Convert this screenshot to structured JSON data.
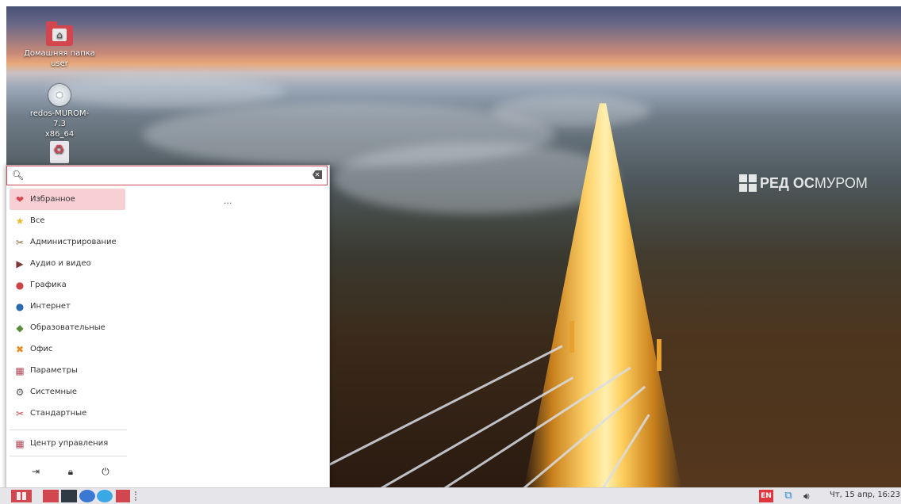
{
  "desktop": {
    "icons": [
      {
        "label_line1": "Домашняя папка",
        "label_line2": "user"
      },
      {
        "label_line1": "redos-MUROM-7.3",
        "label_line2": "x86_64"
      }
    ],
    "watermark": {
      "part1": "РЕД ОС",
      "part2": "МУРОМ"
    }
  },
  "menu": {
    "search": {
      "value": "",
      "placeholder": ""
    },
    "categories": [
      {
        "label": "Избранное",
        "icon": "heart-icon",
        "active": true
      },
      {
        "label": "Все",
        "icon": "star-icon"
      },
      {
        "label": "Администрирование",
        "icon": "tools-icon"
      },
      {
        "label": "Аудио и видео",
        "icon": "film-icon"
      },
      {
        "label": "Графика",
        "icon": "palette-icon"
      },
      {
        "label": "Интернет",
        "icon": "globe-icon"
      },
      {
        "label": "Образовательные",
        "icon": "education-icon"
      },
      {
        "label": "Офис",
        "icon": "office-icon"
      },
      {
        "label": "Параметры",
        "icon": "settings-icon"
      },
      {
        "label": "Системные",
        "icon": "system-gears-icon"
      },
      {
        "label": "Стандартные",
        "icon": "accessories-icon"
      }
    ],
    "control_center": "Центр управления",
    "ellipsis": "...",
    "colors": {
      "accent": "#d2464f",
      "active_bg": "#f8d0d4"
    }
  },
  "taskbar": {
    "lang": "EN",
    "clock": "Чт, 15 апр, 16:23"
  }
}
